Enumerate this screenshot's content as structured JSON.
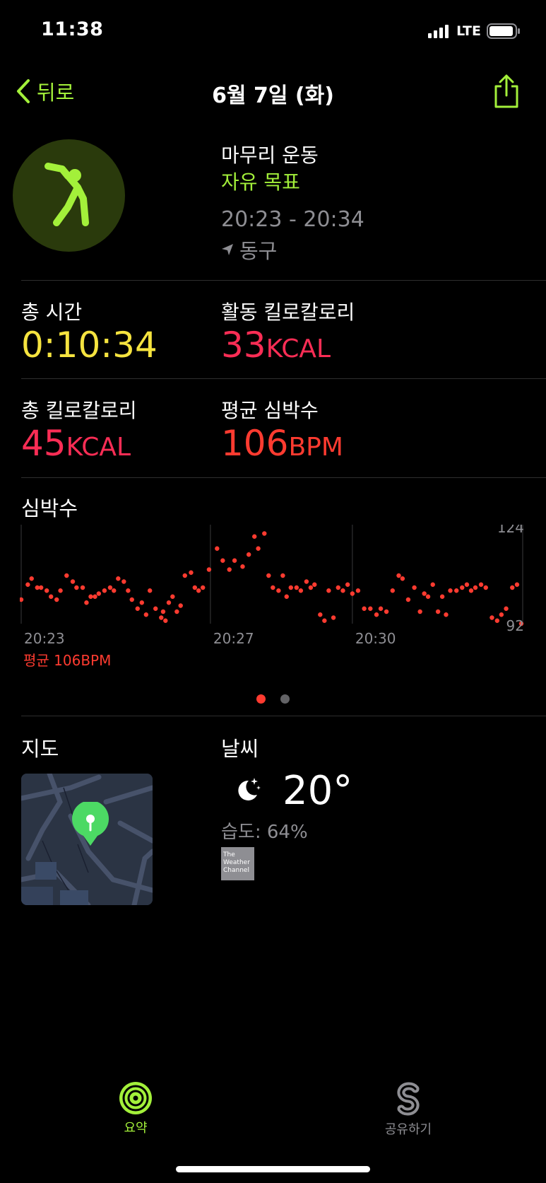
{
  "status_bar": {
    "time": "11:38",
    "network": "LTE"
  },
  "nav": {
    "back_label": "뒤로",
    "title": "6월 7일 (화)"
  },
  "workout": {
    "name": "마무리 운동",
    "goal": "자유 목표",
    "time_range": "20:23 - 20:34",
    "location": "동구"
  },
  "stats": {
    "total_time_label": "총 시간",
    "total_time_value": "0:10:34",
    "active_kcal_label": "활동 킬로칼로리",
    "active_kcal_value": "33",
    "active_kcal_unit": "KCAL",
    "total_kcal_label": "총 킬로칼로리",
    "total_kcal_value": "45",
    "total_kcal_unit": "KCAL",
    "avg_hr_label": "평균 심박수",
    "avg_hr_value": "106",
    "avg_hr_unit": "BPM"
  },
  "heart_rate": {
    "title": "심박수",
    "average_label": "평균 106BPM",
    "page_index": 1,
    "page_count": 2
  },
  "chart_data": {
    "type": "scatter",
    "title": "",
    "x_tick_labels": [
      "20:23",
      "20:27",
      "20:30"
    ],
    "y_tick_labels": [
      "124",
      "92"
    ],
    "ylim": [
      92,
      124
    ],
    "xlim": [
      0,
      10.6
    ],
    "color": "#ff3b30",
    "grid": "vertical",
    "x": [
      0.0,
      0.14,
      0.22,
      0.34,
      0.42,
      0.54,
      0.63,
      0.75,
      0.83,
      0.96,
      1.09,
      1.17,
      1.3,
      1.38,
      1.47,
      1.56,
      1.64,
      1.76,
      1.88,
      1.96,
      2.05,
      2.17,
      2.26,
      2.34,
      2.46,
      2.55,
      2.64,
      2.72,
      2.84,
      2.96,
      3.0,
      3.05,
      3.12,
      3.2,
      3.29,
      3.37,
      3.46,
      3.59,
      3.67,
      3.75,
      3.84,
      3.97,
      4.14,
      4.26,
      4.4,
      4.51,
      4.68,
      4.81,
      4.93,
      5.01,
      5.14,
      5.23,
      5.32,
      5.44,
      5.53,
      5.61,
      5.7,
      5.82,
      5.91,
      6.03,
      6.12,
      6.2,
      6.32,
      6.41,
      6.5,
      6.6,
      6.7,
      6.8,
      6.9,
      7.0,
      7.12,
      7.25,
      7.38,
      7.51,
      7.6,
      7.72,
      7.85,
      7.98,
      8.06,
      8.18,
      8.31,
      8.43,
      8.52,
      8.6,
      8.7,
      8.81,
      8.9,
      8.98,
      9.07,
      9.2,
      9.32,
      9.42,
      9.51,
      9.6,
      9.72,
      9.82,
      9.95,
      10.06,
      10.15,
      10.25,
      10.38,
      10.48,
      10.57
    ],
    "y": [
      100,
      105,
      107,
      104,
      104,
      103,
      101,
      100,
      103,
      108,
      106,
      104,
      104,
      99,
      101,
      101,
      102,
      103,
      104,
      103,
      107,
      106,
      103,
      100,
      97,
      99,
      95,
      103,
      97,
      94,
      96,
      93,
      99,
      101,
      96,
      98,
      108,
      109,
      104,
      103,
      104,
      110,
      117,
      113,
      110,
      113,
      111,
      115,
      121,
      117,
      122,
      108,
      104,
      103,
      108,
      101,
      104,
      104,
      103,
      106,
      104,
      105,
      95,
      93,
      103,
      94,
      104,
      103,
      105,
      102,
      103,
      97,
      97,
      95,
      97,
      96,
      103,
      108,
      107,
      100,
      104,
      96,
      102,
      101,
      105,
      96,
      101,
      95,
      103,
      103,
      104,
      105,
      103,
      104,
      105,
      104,
      94,
      93,
      95,
      97,
      104,
      105,
      92
    ]
  },
  "sections": {
    "map_title": "지도",
    "weather_title": "날씨"
  },
  "weather": {
    "temperature": "20°",
    "humidity": "습도: 64%",
    "provider": "The Weather Channel",
    "icon": "moon-stars-icon"
  },
  "tabs": {
    "summary_label": "요약",
    "share_label": "공유하기"
  },
  "colors": {
    "accent": "#a3f03a",
    "time_yellow": "#f5e33f",
    "kcal_pink": "#fa2d55",
    "heart_red": "#ff3b30"
  }
}
